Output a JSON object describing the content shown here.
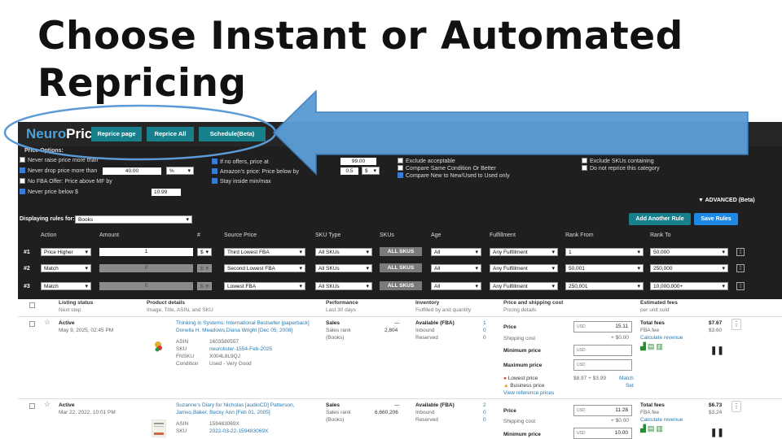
{
  "slide": {
    "title": "Choose Instant or Automated Repricing"
  },
  "toolbar": {
    "logo_prefix": "Neuro",
    "logo_suffix": "Price",
    "reprice_page": "Reprice page",
    "reprice_all": "Reprice All",
    "schedule": "Schedule(Beta)"
  },
  "options": {
    "heading": "Price Options:",
    "col1": [
      {
        "label": "Never raise price more than",
        "checked": false
      },
      {
        "label": "Never drop price more than",
        "checked": true,
        "value": "40.00",
        "unit": "%"
      },
      {
        "label": "No FBA Offer: Price above MF by",
        "checked": false
      },
      {
        "label": "Never price below $",
        "checked": true,
        "value": "10.99"
      }
    ],
    "col2": [
      {
        "label": "If no offers, price at",
        "checked": true,
        "value": "99.00"
      },
      {
        "label": "Amazon's price: Price below by",
        "checked": true,
        "value": "0.5",
        "unit": "$"
      },
      {
        "label": "Stay inside min/max",
        "checked": true
      }
    ],
    "col3": [
      {
        "label": "Exclude acceptable",
        "checked": false
      },
      {
        "label": "Compare Same Condition Or Better",
        "checked": false
      },
      {
        "label": "Compare New to New/Used to Used only",
        "checked": true
      }
    ],
    "col4": [
      {
        "label": "Exclude SKUs containing",
        "checked": false
      },
      {
        "label": "Do not reprice this category",
        "checked": false
      }
    ],
    "advanced": "▼ ADVANCED (Beta)"
  },
  "rules": {
    "display_label": "Displaying rules for:",
    "category": "Books",
    "add_rule": "Add Another Rule",
    "save_rules": "Save Rules",
    "headers": [
      "Action",
      "Amount",
      "#",
      "Source Price",
      "SKU Type",
      "SKUs",
      "Age",
      "Fulfillment",
      "Rank From",
      "Rank To"
    ],
    "rows": [
      {
        "num": "#1",
        "action": "Price Higher",
        "amount": "1",
        "unit": "$",
        "source": "Third Lowest FBA",
        "sku_type": "All SKUs",
        "skus": "ALL SKUS",
        "age": "All",
        "fulfillment": "Any Fulfillment",
        "rank_from": "1",
        "rank_to": "50,000"
      },
      {
        "num": "#2",
        "action": "Match",
        "amount": "0",
        "unit": "$",
        "source": "Second Lowest FBA",
        "sku_type": "All SKUs",
        "skus": "ALL SKUS",
        "age": "All",
        "fulfillment": "Any Fulfillment",
        "rank_from": "50,001",
        "rank_to": "250,000"
      },
      {
        "num": "#3",
        "action": "Match",
        "amount": "0",
        "unit": "$",
        "source": "Lowest FBA",
        "sku_type": "All SKUs",
        "skus": "ALL SKUS",
        "age": "All",
        "fulfillment": "Any Fulfillment",
        "rank_from": "250,001",
        "rank_to": "10,000,000+"
      }
    ]
  },
  "listings": {
    "headers": [
      {
        "title": "Listing status",
        "sub": "Next step"
      },
      {
        "title": "Product details",
        "sub": "Image, Title, ASIN, and SKU"
      },
      {
        "title": "Performance",
        "sub": "Last 30 days"
      },
      {
        "title": "Inventory",
        "sub": "Fulfilled by and quantity"
      },
      {
        "title": "Price and shipping cost",
        "sub": "Pricing details"
      },
      {
        "title": "Estimated fees",
        "sub": "per unit sold"
      }
    ],
    "items": [
      {
        "status": "Active",
        "date": "May 9, 2025, 02:45 PM",
        "title": "Thinking in Systems: International Bestseller [paperback]",
        "authors": "Donella H. Meadows,Diana Wright [Dec 05, 2008]",
        "asin": "1603580557",
        "sku": "neurolister-1554-Feb-2025",
        "fnsku": "X004L8L9QJ",
        "condition": "Used - Very Good",
        "sales_label": "Sales",
        "sales_val": "—",
        "rank_label": "Sales rank",
        "rank_val": "2,804",
        "category": "(Books)",
        "avail_label": "Available (FBA)",
        "avail_val": "1",
        "inbound_val": "0",
        "reserved_val": "0",
        "price": "15.11",
        "shipping": "+ $0.00",
        "min_price": "",
        "max_price": "",
        "lowest_price_label": "Lowest price",
        "lowest_price": "$8.97 + $3.99",
        "match": "Match",
        "business_price": "Business price",
        "set": "Set",
        "reference": "View reference prices",
        "total_fees": "$7.67",
        "fba_fee": "$3.60"
      },
      {
        "status": "Active",
        "date": "Mar 22, 2022, 10:01 PM",
        "title": "Suzanne's Diary for Nicholas [audioCD] Patterson,",
        "authors": "James,Baker, Becky Ann [Feb 01, 2005]",
        "asin": "159483069X",
        "sku": "2022-03-22-159483069X",
        "fnsku": "",
        "sales_label": "Sales",
        "sales_val": "—",
        "rank_label": "Sales rank",
        "rank_val": "6,660,206",
        "category": "(Books)",
        "avail_label": "Available (FBA)",
        "avail_val": "2",
        "inbound_val": "0",
        "reserved_val": "0",
        "price": "11.28",
        "shipping": "+ $0.00",
        "min_price": "10.00",
        "total_fees": "$6.73",
        "fba_fee": "$3.24"
      }
    ],
    "labels": {
      "asin": "ASIN",
      "sku": "SKU",
      "fnsku": "FNSKU",
      "condition": "Condition",
      "inbound": "Inbound",
      "reserved": "Reserved",
      "price": "Price",
      "shipping": "Shipping cost",
      "min": "Minimum price",
      "max": "Maximum price",
      "currency": "USD",
      "total_fees": "Total fees",
      "fba_fee": "FBA fee",
      "calc": "Calculate revenue"
    }
  },
  "colors": {
    "teal": "#17808c",
    "blue": "#1e88e5",
    "annotation": "#5b9bd5",
    "panel": "#1f1f1f"
  }
}
